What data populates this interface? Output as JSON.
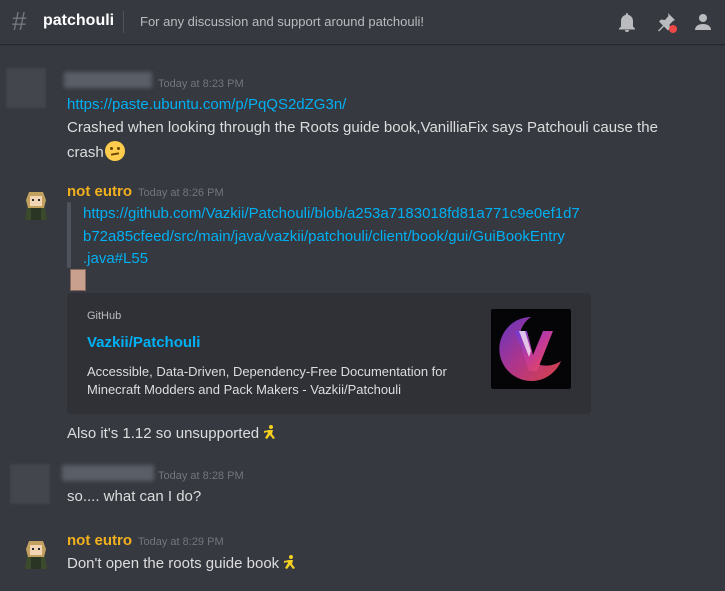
{
  "header": {
    "channel_name": "patchouli",
    "topic": "For any discussion and support around patchouli!",
    "icons": [
      "bell-icon",
      "pin-icon",
      "members-icon"
    ]
  },
  "messages": [
    {
      "author_hidden": true,
      "timestamp": "Today at 8:23 PM",
      "link": "https://paste.ubuntu.com/p/PqQS2dZG3n/",
      "text": "Crashed when looking through the Roots guide book,VanilliaFix says Patchouli cause the",
      "text2": "crash",
      "emoji": "thinking-face"
    },
    {
      "author": "not eutro",
      "timestamp": "Today at 8:26 PM",
      "link_lines": [
        "https://github.com/Vazkii/Patchouli/blob/a253a7183018fd81a771c9e0ef1d7",
        "b72a85cfeed/src/main/java/vazkii/patchouli/client/book/gui/GuiBookEntry",
        ".java#L55"
      ],
      "embed": {
        "provider": "GitHub",
        "title": "Vazkii/Patchouli",
        "description": "Accessible, Data-Driven, Dependency-Free Documentation for Minecraft Modders and Pack Makers - Vazkii/Patchouli"
      },
      "followup": "Also it's 1.12 so unsupported"
    },
    {
      "author_hidden": true,
      "timestamp": "Today at 8:28 PM",
      "text": "so.... what can I do?"
    },
    {
      "author": "not eutro",
      "timestamp": "Today at 8:29 PM",
      "text": "Don't open the roots guide book"
    }
  ],
  "colors": {
    "background": "#36393f",
    "username": "#f2b01e",
    "link": "#00b0f4",
    "embed_bg": "#2f3136"
  }
}
